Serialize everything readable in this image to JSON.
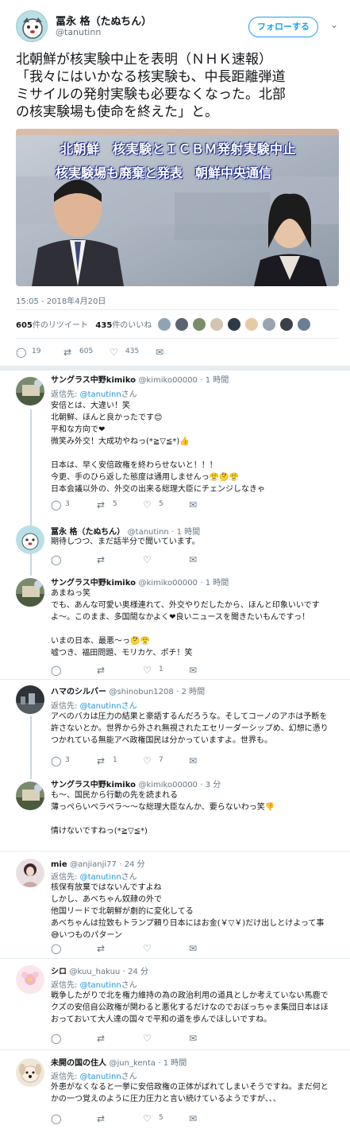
{
  "tweet": {
    "author_name": "冨永 格（たぬちん）",
    "author_handle": "@tanutinn",
    "follow_label": "フォローする",
    "text_lines": [
      "北朝鮮が核実験中止を表明（ＮＨＫ速報）",
      "「我々にはいかなる核実験も、中長距離弾道",
      "ミサイルの発射実験も必要なくなった。北部",
      "の核実験場も使命を終えた」と。"
    ],
    "media_caption_1": "北朝鮮　核実験とＩＣＢＭ発射実験中止",
    "media_caption_2": "核実験場も廃棄と発表　朝鮮中央通信",
    "timestamp": "15:05 - 2018年4月20日",
    "retweet_count": "605",
    "retweet_label": "件のリツイート",
    "like_count": "435",
    "like_label": "件のいいね",
    "actions": {
      "reply": "19",
      "retweet": "605",
      "like": "435"
    }
  },
  "replies": [
    {
      "name": "サングラス中野kimiko",
      "handle": "@kimiko00000",
      "time": "· 1 時間",
      "reply_to_prefix": "返信先: ",
      "reply_to": "@tanutinn",
      "reply_to_suffix": "さん",
      "lines": [
        "安倍とは、大違い！笑",
        "北朝鮮、ほんと良かったです😊",
        "平和な方向で❤",
        "微笑み外交！大成功やねっ(*≧▽≦*)👍",
        "",
        "日本は、早く安倍政権を終わらせないと！！！",
        "今更、手のひら返した態度は通用しませんっ😤🤔😤",
        "日本会議以外の、外交の出来る総理大臣にチェンジしなきゃ"
      ],
      "actions": {
        "reply": "3",
        "retweet": "5",
        "like": "5"
      }
    },
    {
      "name": "冨永 格（たぬちん）",
      "handle": "@tanutinn",
      "time": "· 1 時間",
      "lines": [
        "期待しつつ、まだ話半分で聞いています。"
      ],
      "actions": {
        "reply": "",
        "retweet": "",
        "like": ""
      }
    },
    {
      "name": "サングラス中野kimiko",
      "handle": "@kimiko00000",
      "time": "· 1 時間",
      "lines": [
        "あまねっ笑",
        "でも、あんな可愛い奥様連れて、外交やりだしたから、ほんと印象いいです",
        "よ〜。このまま、多国間なかよく❤良いニュースを聞きたいもんですっ！",
        "",
        "いまの日本、最悪〜っ🤔😤",
        "嘘つき、福田問題、モリカケ、ポチ！笑"
      ],
      "actions": {
        "reply": "",
        "retweet": "",
        "like": "1"
      }
    },
    {
      "name": "ハマのシルバー",
      "handle": "@shinobun1208",
      "time": "· 2 時間",
      "reply_to_prefix": "返信先: ",
      "reply_to": "@tanutinnさん",
      "reply_to_suffix": "",
      "lines": [
        "アベのバカは圧力の結果と豪語するんだろうな。そしてコーノのアホは予断を",
        "許さないとか。世界から外され無視されたエセリーダーシップめ、幻想に憑り",
        "つかれている無能アベ政権国民は分かっていますよ。世界も。"
      ],
      "actions": {
        "reply": "3",
        "retweet": "1",
        "like": "7"
      }
    },
    {
      "name": "サングラス中野kimiko",
      "handle": "@kimiko00000",
      "time": "· 3 分",
      "lines": [
        "も〜、国民から行動の先を読まれる",
        "薄っぺらいペラペラ〜〜な総理大臣なんか、要らないわっ笑👎",
        "",
        "情けないですねっ(*≧▽≦*)"
      ],
      "actions": {
        "reply": "",
        "retweet": "",
        "like": ""
      }
    },
    {
      "name": "mie",
      "handle": "@anjianji77",
      "time": "· 24 分",
      "reply_to_prefix": "返信先: ",
      "reply_to": "@tanutinn",
      "reply_to_suffix": "さん",
      "lines": [
        "核保有放棄ではないんですよね",
        "しかし、あべちゃん奴隷の外で",
        "他国リードで北朝鮮が劇的に変化してる",
        "あべちゃんは拉致もトランプ頼り日本にはお金(￥▽￥)だけ出しとけよって事",
        "😅いつものパターン"
      ],
      "actions": {
        "reply": "",
        "retweet": "",
        "like": ""
      }
    },
    {
      "name": "シロ",
      "handle": "@kuu_hakuu",
      "time": "· 24 分",
      "reply_to_prefix": "返信先: ",
      "reply_to": "@tanutinn",
      "reply_to_suffix": "さん",
      "lines": [
        "戦争したがりで北を権力維持の為の政治利用の道具としか考えていない馬鹿で",
        "クズの安倍自公政権が関わると悪化するだけなのでおぼっちゃま集団日本はほ",
        "おっておいて大人達の国々で平和の道を歩んでほしいですね。"
      ],
      "actions": {
        "reply": "",
        "retweet": "",
        "like": ""
      }
    },
    {
      "name": "未開の国の住人",
      "handle": "@jun_kenta",
      "time": "· 1 時間",
      "reply_to_prefix": "返信先: ",
      "reply_to": "@tanutinn",
      "reply_to_suffix": "さん",
      "lines": [
        "外患がなくなると一挙に安倍政権の正体がばれてしまいそうですね。まだ何と",
        "かの一つ覚えのように圧力圧力と言い続けているようですが、、、"
      ],
      "actions": {
        "reply": "",
        "retweet": "",
        "like": "5"
      }
    }
  ]
}
